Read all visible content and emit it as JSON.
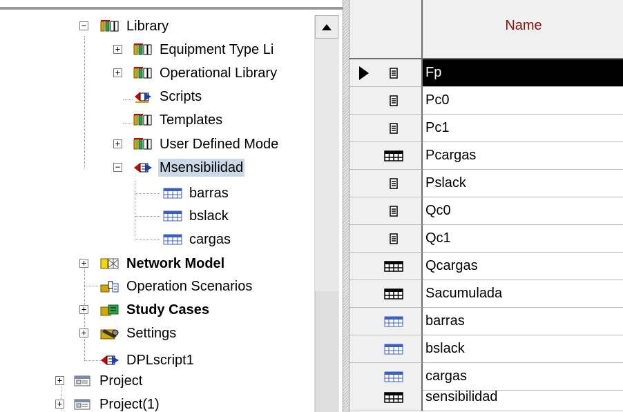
{
  "tree": {
    "nodes": [
      {
        "label": "Library",
        "icon": "library-icon",
        "toggle": "−"
      },
      {
        "label": "Equipment Type Li",
        "icon": "library-icon",
        "toggle": "+"
      },
      {
        "label": "Operational Library",
        "icon": "library-icon",
        "toggle": "+"
      },
      {
        "label": "Scripts",
        "icon": "script-folder-icon",
        "toggle": ""
      },
      {
        "label": "Templates",
        "icon": "library-icon",
        "toggle": ""
      },
      {
        "label": "User Defined Mode",
        "icon": "library-icon",
        "toggle": "+"
      },
      {
        "label": "Msensibilidad",
        "icon": "dpl-command-icon",
        "toggle": "−"
      },
      {
        "label": "barras",
        "icon": "matrix-light-icon",
        "toggle": ""
      },
      {
        "label": "bslack",
        "icon": "matrix-light-icon",
        "toggle": ""
      },
      {
        "label": "cargas",
        "icon": "matrix-light-icon",
        "toggle": ""
      },
      {
        "label": "Network Model",
        "icon": "network-model-icon",
        "toggle": "+"
      },
      {
        "label": "Operation Scenarios",
        "icon": "operation-scenarios-icon",
        "toggle": ""
      },
      {
        "label": "Study Cases",
        "icon": "study-cases-icon",
        "toggle": "+"
      },
      {
        "label": "Settings",
        "icon": "settings-folder-icon",
        "toggle": "+"
      },
      {
        "label": "DPLscript1",
        "icon": "dpl-command-icon",
        "toggle": ""
      },
      {
        "label": "Project",
        "icon": "project-icon",
        "toggle": "+"
      },
      {
        "label": "Project(1)",
        "icon": "project-icon",
        "toggle": "+"
      }
    ]
  },
  "grid": {
    "header": {
      "name": "Name"
    },
    "rows": [
      {
        "name": "Fp",
        "icon": "scalar-icon"
      },
      {
        "name": "Pc0",
        "icon": "scalar-icon"
      },
      {
        "name": "Pc1",
        "icon": "scalar-icon"
      },
      {
        "name": "Pcargas",
        "icon": "matrix-icon"
      },
      {
        "name": "Pslack",
        "icon": "scalar-icon"
      },
      {
        "name": "Qc0",
        "icon": "scalar-icon"
      },
      {
        "name": "Qc1",
        "icon": "scalar-icon"
      },
      {
        "name": "Qcargas",
        "icon": "matrix-icon"
      },
      {
        "name": "Sacumulada",
        "icon": "matrix-icon"
      },
      {
        "name": "barras",
        "icon": "matrix-light-icon"
      },
      {
        "name": "bslack",
        "icon": "matrix-light-icon"
      },
      {
        "name": "cargas",
        "icon": "matrix-light-icon"
      },
      {
        "name": "sensibilidad",
        "icon": "matrix-icon"
      }
    ]
  },
  "colors": {
    "header_text": "#8b1010",
    "selection": "#cbd8e6",
    "row_selected_bg": "#000000"
  }
}
